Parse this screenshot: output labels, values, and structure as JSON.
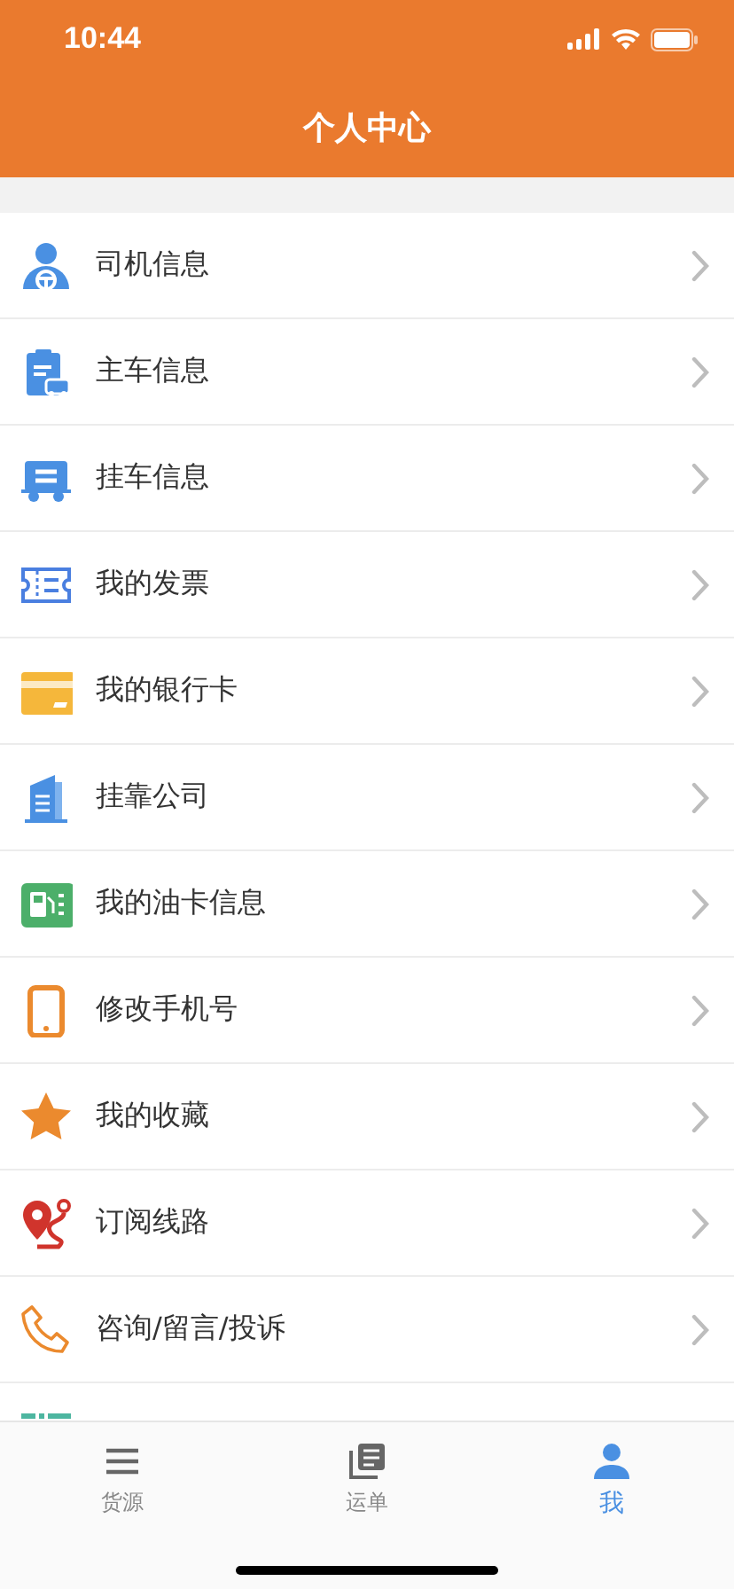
{
  "status_bar": {
    "time": "10:44"
  },
  "header": {
    "title": "个人中心"
  },
  "menu": [
    {
      "label": "司机信息"
    },
    {
      "label": "主车信息"
    },
    {
      "label": "挂车信息"
    },
    {
      "label": "我的发票"
    },
    {
      "label": "我的银行卡"
    },
    {
      "label": "挂靠公司"
    },
    {
      "label": "我的油卡信息"
    },
    {
      "label": "修改手机号"
    },
    {
      "label": "我的收藏"
    },
    {
      "label": "订阅线路"
    },
    {
      "label": "咨询/留言/投诉"
    }
  ],
  "tabs": [
    {
      "label": "货源",
      "selected": false
    },
    {
      "label": "运单",
      "selected": false
    },
    {
      "label": "我",
      "selected": true
    }
  ]
}
